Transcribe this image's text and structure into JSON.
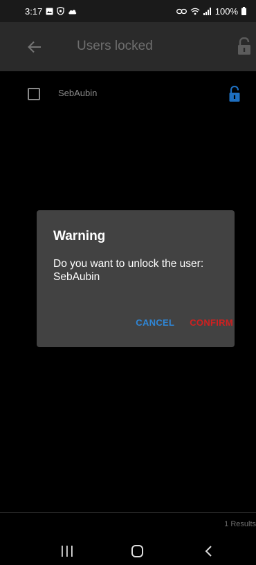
{
  "status_bar": {
    "time": "3:17",
    "battery": "100%",
    "icons": [
      "gallery-icon",
      "shield-icon",
      "cloud-icon",
      "link-icon",
      "wifi-icon",
      "signal-icon",
      "battery-icon"
    ]
  },
  "app_bar": {
    "title": "Users locked",
    "back_icon": "arrow-back-icon",
    "action_icon": "unlock-icon"
  },
  "list": {
    "items": [
      {
        "username": "SebAubin",
        "checked": false,
        "icon": "unlock-icon"
      }
    ]
  },
  "dialog": {
    "title": "Warning",
    "message": "Do you want to unlock the user: SebAubin",
    "cancel_label": "CANCEL",
    "confirm_label": "CONFIRM"
  },
  "footer": {
    "results_text": "1 Results"
  },
  "colors": {
    "accent_blue": "#2f86d6",
    "confirm_red": "#d02020",
    "dialog_bg": "#424242",
    "app_bar_bg": "#2a2a2a"
  }
}
